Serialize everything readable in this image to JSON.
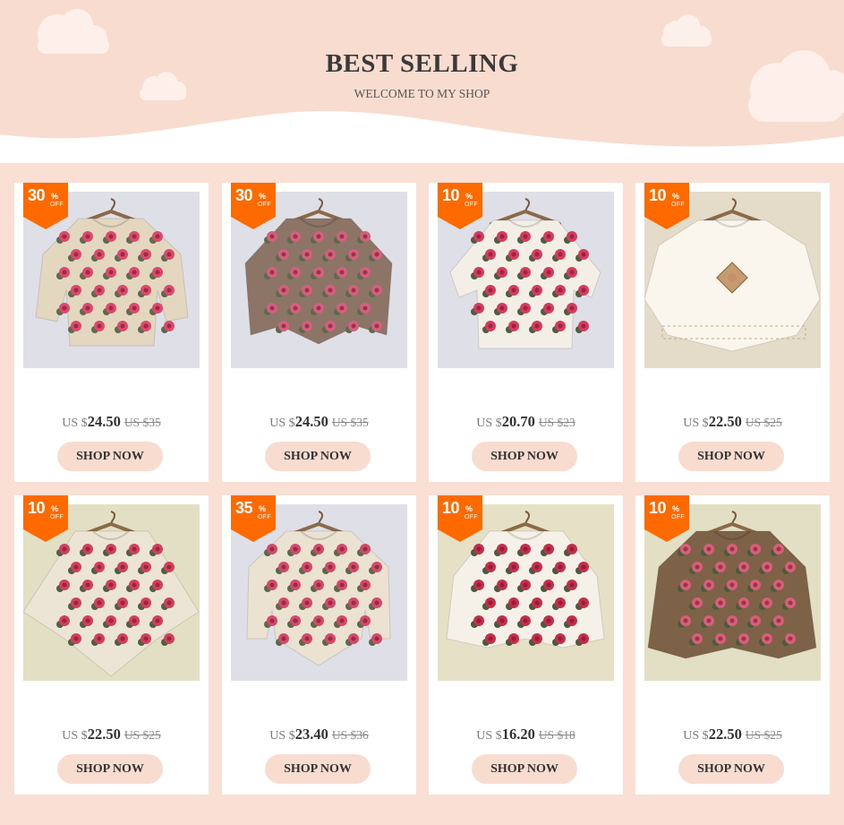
{
  "header": {
    "title": "BEST SELLING",
    "subtitle": "WELCOME TO MY SHOP"
  },
  "colors": {
    "page_bg": "#f9dfd4",
    "badge": "#ff6a00",
    "button_bg": "#f9dcd0",
    "cloud": "#fdf0ea"
  },
  "products": [
    {
      "discount": "30",
      "pct": "%",
      "off": "OFF",
      "currency": "US $",
      "price": "24.50",
      "original": "US $35",
      "button": "SHOP NOW",
      "image": "beige-crochet-rose-top",
      "bg": "#dedfe7",
      "garment": "#e4d7c0",
      "rose": "#d94a6d",
      "leaf": "#5c6b4a"
    },
    {
      "discount": "30",
      "pct": "%",
      "off": "OFF",
      "currency": "US $",
      "price": "24.50",
      "original": "US $35",
      "button": "SHOP NOW",
      "image": "mauve-crochet-poncho-top",
      "bg": "#dedfe7",
      "garment": "#8c7466",
      "rose": "#d2607e",
      "leaf": "#5c6b4a"
    },
    {
      "discount": "10",
      "pct": "%",
      "off": "OFF",
      "currency": "US $",
      "price": "20.70",
      "original": "US $23",
      "button": "SHOP NOW",
      "image": "white-crochet-rose-cardigan",
      "bg": "#dedfe7",
      "garment": "#f3efe6",
      "rose": "#d23c5e",
      "leaf": "#4d5e40"
    },
    {
      "discount": "10",
      "pct": "%",
      "off": "OFF",
      "currency": "US $",
      "price": "22.50",
      "original": "US $25",
      "button": "SHOP NOW",
      "image": "white-mohair-poncho-sweater",
      "bg": "#e4dcc8",
      "garment": "#faf6ee",
      "rose": "#c8906a",
      "leaf": "#7a6a50"
    },
    {
      "discount": "10",
      "pct": "%",
      "off": "OFF",
      "currency": "US $",
      "price": "22.50",
      "original": "US $25",
      "button": "SHOP NOW",
      "image": "fringe-crochet-rose-poncho",
      "bg": "#e3dfc4",
      "garment": "#ece4d5",
      "rose": "#cf3f5e",
      "leaf": "#4f5f42"
    },
    {
      "discount": "35",
      "pct": "%",
      "off": "OFF",
      "currency": "US $",
      "price": "23.40",
      "original": "US $36",
      "button": "SHOP NOW",
      "image": "cream-crochet-rose-pullover",
      "bg": "#dedfe7",
      "garment": "#ebe2d2",
      "rose": "#d04a6a",
      "leaf": "#5a6a48"
    },
    {
      "discount": "10",
      "pct": "%",
      "off": "OFF",
      "currency": "US $",
      "price": "16.20",
      "original": "US $18",
      "button": "SHOP NOW",
      "image": "white-mohair-rose-capelet",
      "bg": "#e6e0c6",
      "garment": "#f6f1e8",
      "rose": "#c02f4c",
      "leaf": "#4a5a3c"
    },
    {
      "discount": "10",
      "pct": "%",
      "off": "OFF",
      "currency": "US $",
      "price": "22.50",
      "original": "US $25",
      "button": "SHOP NOW",
      "image": "brown-crochet-rose-cape",
      "bg": "#e3dfc4",
      "garment": "#7d6248",
      "rose": "#d65f7a",
      "leaf": "#4b5b3c"
    }
  ]
}
